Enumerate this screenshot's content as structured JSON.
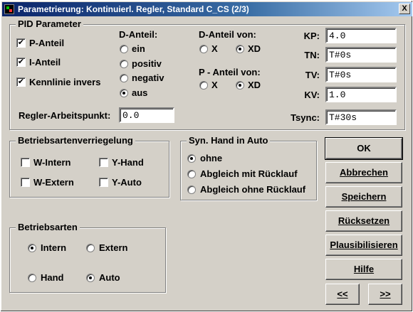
{
  "window": {
    "title": "Parametrierung: Kontinuierl. Regler, Standard  C_CS  (2/3)",
    "close_label": "X"
  },
  "pid": {
    "legend": "PID Parameter",
    "p_anteil": {
      "label": "P-Anteil",
      "checked": true
    },
    "i_anteil": {
      "label": "I-Anteil",
      "checked": true
    },
    "kennlinie": {
      "label": "Kennlinie invers",
      "checked": true
    },
    "d_anteil": {
      "label": "D-Anteil:",
      "options": [
        "ein",
        "positiv",
        "negativ",
        "aus"
      ],
      "selected": "aus"
    },
    "d_anteil_von": {
      "label": "D-Anteil von:",
      "options": [
        "X",
        "XD"
      ],
      "selected": "XD"
    },
    "p_anteil_von": {
      "label": "P - Anteil von:",
      "options": [
        "X",
        "XD"
      ],
      "selected": "XD"
    },
    "arbeitspunkt": {
      "label": "Regler-Arbeitspunkt:",
      "value": "0.0"
    },
    "kp": {
      "label": "KP:",
      "value": "4.0"
    },
    "tn": {
      "label": "TN:",
      "value": "T#0s"
    },
    "tv": {
      "label": "TV:",
      "value": "T#0s"
    },
    "kv": {
      "label": "KV:",
      "value": "1.0"
    },
    "tsync": {
      "label": "Tsync:",
      "value": "T#30s"
    }
  },
  "verriegelung": {
    "legend": "Betriebsartenverriegelung",
    "w_intern": {
      "label": "W-Intern",
      "checked": false
    },
    "y_hand": {
      "label": "Y-Hand",
      "checked": false
    },
    "w_extern": {
      "label": "W-Extern",
      "checked": false
    },
    "y_auto": {
      "label": "Y-Auto",
      "checked": false
    }
  },
  "syn_hand": {
    "legend": "Syn. Hand in Auto",
    "options": [
      "ohne",
      "Abgleich mit Rücklauf",
      "Abgleich ohne Rücklauf"
    ],
    "selected": "ohne"
  },
  "betriebsarten": {
    "legend": "Betriebsarten",
    "intern": {
      "label": "Intern",
      "selected": true
    },
    "extern": {
      "label": "Extern",
      "selected": false
    },
    "hand": {
      "label": "Hand",
      "selected": false
    },
    "auto": {
      "label": "Auto",
      "selected": true
    }
  },
  "buttons": {
    "ok": "OK",
    "abbrechen": "Abbrechen",
    "speichern": "Speichern",
    "ruecksetzen": "Rücksetzen",
    "plausibilisieren": "Plausibilisieren",
    "hilfe": "Hilfe",
    "prev": "<<",
    "next": ">>"
  }
}
